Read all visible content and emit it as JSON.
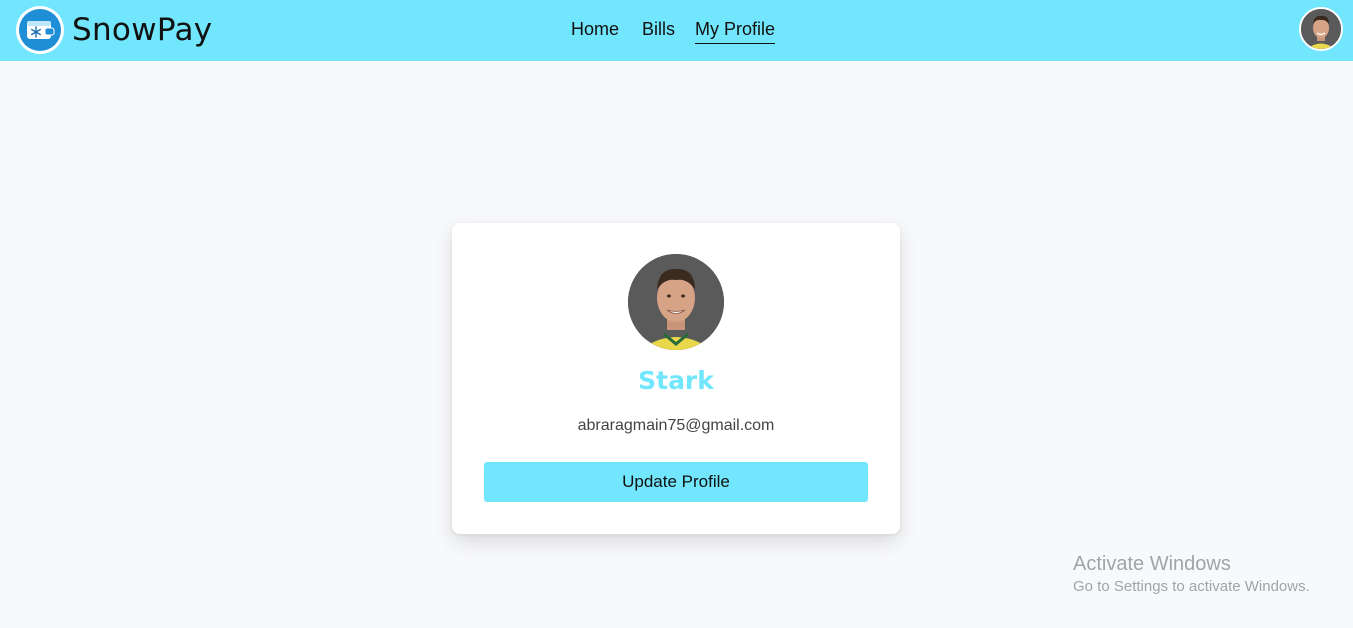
{
  "header": {
    "brand_name": "SnowPay",
    "logo_icon": "wallet-snowflake-icon",
    "nav": [
      {
        "label": "Home",
        "active": false
      },
      {
        "label": "Bills",
        "active": false
      },
      {
        "label": "My Profile",
        "active": true
      }
    ],
    "avatar_icon": "user-avatar"
  },
  "profile": {
    "name": "Stark",
    "email": "abraragmain75@gmail.com",
    "update_button_label": "Update Profile"
  },
  "watermark": {
    "title": "Activate Windows",
    "subtitle": "Go to Settings to activate Windows."
  },
  "colors": {
    "accent": "#71e6fc",
    "page_bg": "#f8f9fb",
    "logo_blue": "#1e8fd6"
  }
}
